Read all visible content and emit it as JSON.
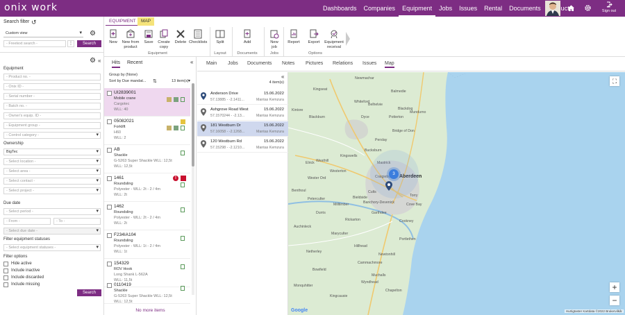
{
  "app": {
    "logo": "onix work",
    "nav": [
      "Dashboards",
      "Companies",
      "Equipment",
      "Jobs",
      "Issues",
      "Rental",
      "Documents",
      "Products"
    ],
    "active_nav": "Equipment",
    "signout": "Sign out"
  },
  "search": {
    "title": "Search filter",
    "view": "Custom view",
    "free_search_placeholder": "- Freetext search -",
    "search_btn": "Search"
  },
  "filters": {
    "equipment_label": "Equipment",
    "product_no": "- Product no. -",
    "onix_id": "- Onix ID -",
    "serial_no": "- Serial number -",
    "batch_no": "- Batch no. -",
    "owner_id": "- Owner's equip. ID -",
    "equipment_group": "- Equipment group -",
    "control_category": "- Control category -",
    "ownership_label": "Ownership",
    "ownership_value": "BigTec",
    "location": "- Select location -",
    "area": "- Select area -",
    "contact": "- Select contact -",
    "project": "- Select project -",
    "due_date_label": "Due date",
    "period": "- Select period -",
    "from": "- From -",
    "to": "- To -",
    "due_date": "- Select due date -",
    "statuses_label": "Filter equipment statuses",
    "statuses": "- Select equipment statuses -",
    "options_label": "Filter options",
    "options": [
      "Hide active",
      "Include inactive",
      "Include discarded",
      "Include missing"
    ],
    "search_btn": "Search"
  },
  "ribbon": {
    "tabs": [
      "EQUIPMENT",
      "MAP"
    ],
    "buttons": [
      {
        "label": "New",
        "icon": "plus-icon"
      },
      {
        "label": "New from product",
        "icon": "box-plus-icon"
      },
      {
        "label": "Save",
        "icon": "save-icon"
      },
      {
        "label": "Create copy",
        "icon": "copy-icon"
      },
      {
        "label": "Delete",
        "icon": "delete-icon"
      },
      {
        "label": "Checklists",
        "icon": "checklist-icon"
      },
      {
        "label": "Split",
        "icon": "split-icon"
      },
      {
        "label": "Add",
        "icon": "document-add-icon"
      },
      {
        "label": "New job",
        "icon": "job-icon"
      },
      {
        "label": "Report",
        "icon": "report-icon"
      },
      {
        "label": "Export",
        "icon": "export-icon"
      },
      {
        "label": "Equipment receival",
        "icon": "receival-icon"
      }
    ],
    "groups": [
      "Equipment",
      "Layout",
      "Documents",
      "Jobs",
      "Options"
    ]
  },
  "list": {
    "tabs": [
      "Hits",
      "Recent"
    ],
    "group_by": "Group by (None)",
    "sort_by": "Sort by Due mandat...",
    "count": "13 item(s)",
    "more": "No more items",
    "items": [
      {
        "title": "UI2839001",
        "l1": "Mobile crane",
        "l2": "Cargotec",
        "l3": "WLL: 40"
      },
      {
        "title": "05082021",
        "l1": "Forklift",
        "l2": "H60",
        "l3": "WLL: 2"
      },
      {
        "title": "AB",
        "l1": "Shackle",
        "l2": "G-5263 Super Shackle WLL: 12,5t",
        "l3": "WLL: 12,5t"
      },
      {
        "title": "1461",
        "l1": "Roundsling",
        "l2": "Polyester - WLL: 2t - 2 / 4m",
        "l3": "WLL: 2t"
      },
      {
        "title": "1462",
        "l1": "Roundsling",
        "l2": "Polyester - WLL: 2t - 2 / 4m",
        "l3": "WLL: 2t"
      },
      {
        "title": "F234IA104",
        "l1": "Roundsling",
        "l2": "Polyester - WLL: 1t - 2 / 4m",
        "l3": "WLL: 1t"
      },
      {
        "title": "154329",
        "l1": "ROV Hook",
        "l2": "Long Shank L-562A",
        "l3": "WLL: 11,5t"
      },
      {
        "title": "0110419",
        "l1": "Shackle",
        "l2": "G-5263 Super Shackle WLL: 12,5t",
        "l3": "WLL: 12,5t"
      }
    ]
  },
  "detail": {
    "tabs": [
      "Main",
      "Jobs",
      "Documents",
      "Notes",
      "Pictures",
      "Relations",
      "Issues",
      "Map"
    ],
    "active_tab": "Map",
    "jobs_count": "4 item(s)",
    "jobs": [
      {
        "name": "Anderson Drive",
        "date": "15.06.2022",
        "coords": "57.13885 - -2.1411...",
        "user": "Mantas Kemzura"
      },
      {
        "name": "Ashgrove Road West",
        "date": "15.06.2022",
        "coords": "57.1570244 - -2.13...",
        "user": "Mantas Kemzura"
      },
      {
        "name": "181 Westburn Dr",
        "date": "15.06.2022",
        "coords": "57.16058 - -2.1268...",
        "user": "Mantas Kemzura"
      },
      {
        "name": "120 Westburn Rd",
        "date": "15.06.2022",
        "coords": "57.15298 - -2.1210...",
        "user": "Mantas Kemzura"
      }
    ]
  },
  "map": {
    "places": [
      "Newmachar",
      "Kingseat",
      "Balmedie",
      "Whiteford",
      "Blackdog",
      "Kintore",
      "Blackburn",
      "Dyce",
      "Potterton",
      "Belhelvie",
      "Mundurno",
      "Bridge of Don",
      "Perslay",
      "Aberdeen",
      "Westhill",
      "Kingswells",
      "Elrick",
      "Westerton",
      "Wester Ord",
      "Benthoul",
      "Bieldside",
      "Cults",
      "Torry",
      "Cove Bay",
      "Peterculter",
      "Milltimber",
      "Banchory-Devenick",
      "Maryculter",
      "Cookney",
      "Netherley",
      "Newtonhill",
      "Muchalls",
      "Craigiebuckler",
      "Mastrick",
      "Bucksburn",
      "Portlethen",
      "Bowfield",
      "Cammachmore",
      "Garthdee",
      "Auchinleck",
      "Monquhitter",
      "Kingcausie",
      "Rickarton",
      "Durris",
      "Hillhead",
      "Wyndhead",
      "Chapelton"
    ],
    "cluster_count": "3",
    "footer": "Hurtigtaster  Kartdata ©2022  Brukervilkår",
    "brand": "Google"
  }
}
